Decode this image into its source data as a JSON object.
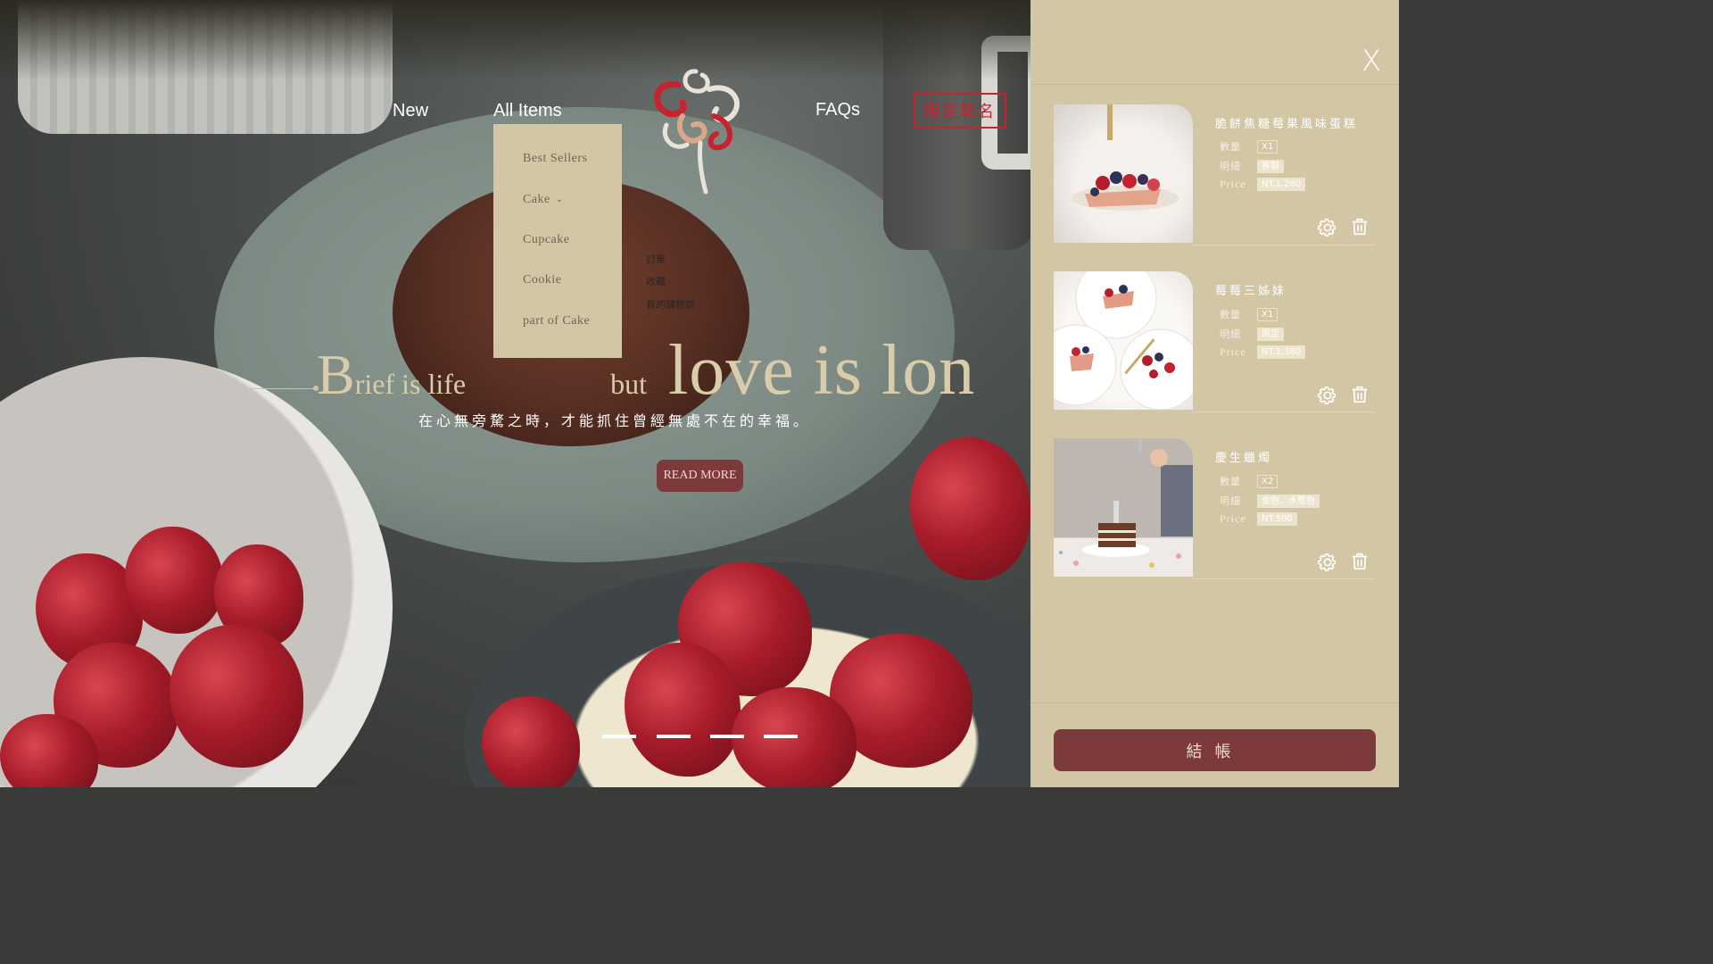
{
  "nav": {
    "new": "New",
    "all_items": "All Items",
    "faqs": "FAQs",
    "limited": "限定聯名"
  },
  "dropdown": {
    "items": [
      "Best Sellers",
      "Cake",
      "Cupcake",
      "Cookie",
      "part of Cake"
    ]
  },
  "ghost_menu": [
    "訂單",
    "收藏",
    "我的購物袋"
  ],
  "hero": {
    "headline_b": "B",
    "headline_rief": "rief is life",
    "headline_but": "but",
    "headline_love": "love is lon",
    "subtitle": "在心無旁騖之時，才能抓住曾經無處不在的幸福。",
    "read_more": "READ MORE",
    "slides": 4
  },
  "cart": {
    "close": "X",
    "labels": {
      "qty": "數量",
      "detail": "明細",
      "price": "Price"
    },
    "items": [
      {
        "name": "脆餅焦糖莓果風味蛋糕",
        "qty": "X1",
        "detail": "客製",
        "price": "NT.1,280"
      },
      {
        "name": "莓莓三姊妹",
        "qty": "X1",
        "detail": "原定",
        "price": "NT.1,380"
      },
      {
        "name": "慶生蠟燭",
        "qty": "X2",
        "detail": "金色、水藍色",
        "price": "NT.500"
      }
    ],
    "checkout": "結帳"
  },
  "colors": {
    "panel": "#d2c6a4",
    "accent": "#7d3a3c",
    "brand_red": "#c8222e"
  }
}
